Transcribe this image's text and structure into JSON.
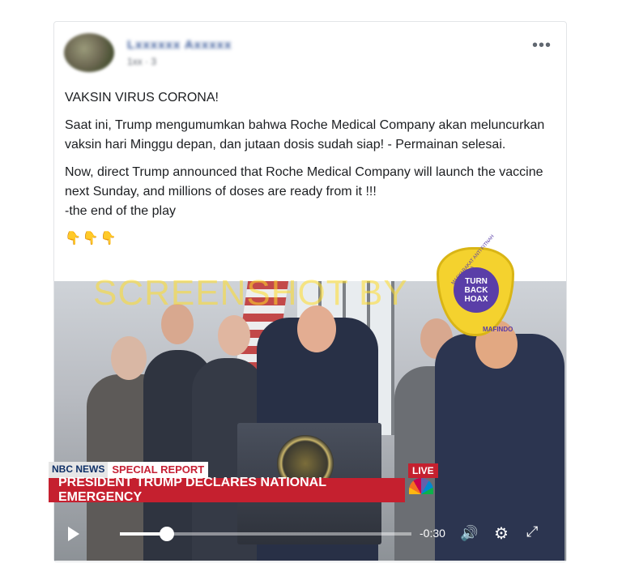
{
  "post": {
    "author_name": "Lxxxxxx Axxxxx",
    "time": "1xx · 3",
    "more_label": "•••",
    "title": "VAKSIN VIRUS CORONA!",
    "paragraph_id": "Saat ini, Trump mengumumkan bahwa Roche Medical Company akan meluncurkan vaksin hari Minggu depan, dan jutaan dosis sudah siap! - Permainan selesai.",
    "paragraph_en_1": "Now, direct Trump announced that Roche Medical Company will launch the vaccine next Sunday, and millions of doses are ready from it !!!",
    "paragraph_en_2": "-the end of the play",
    "emojis": "👇👇👇"
  },
  "watermark": {
    "text": "SCREENSHOT BY",
    "badge_center": "TURN BACK HOAX",
    "badge_ring": "MASYARAKAT ANTI FITNAH INDONESIA",
    "badge_bottom": "MAFINDO"
  },
  "video": {
    "network": "NBC NEWS",
    "segment": "SPECIAL REPORT",
    "headline": "PRESIDENT TRUMP DECLARES NATIONAL EMERGENCY",
    "live_label": "LIVE",
    "time_remaining": "-0:30",
    "progress": 0.16
  },
  "icons": {
    "play": "play-icon",
    "volume": "volume-icon",
    "settings": "gear-icon",
    "fullscreen": "fullscreen-icon"
  },
  "colors": {
    "link_blue": "#385898",
    "news_red": "#c5202f",
    "badge_yellow": "#f4d22e",
    "badge_purple": "#5a3ea8"
  }
}
